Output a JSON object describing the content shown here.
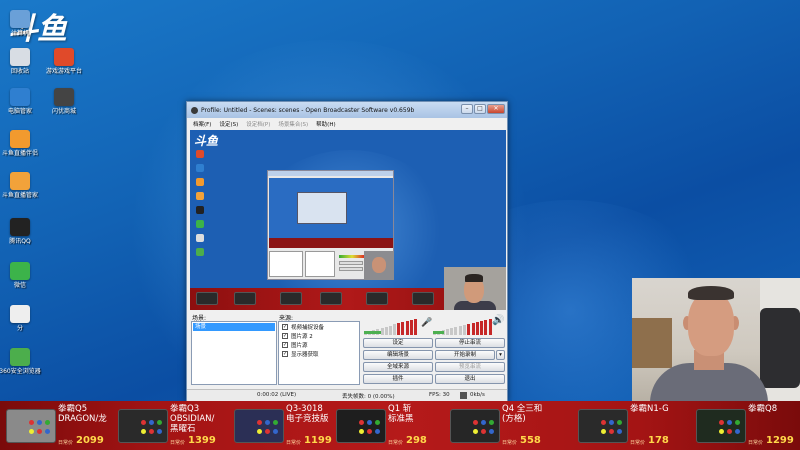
{
  "brand": {
    "logo_text": "斗鱼"
  },
  "desktop_icons": [
    {
      "label": "计算机",
      "color": "#6aa0d8"
    },
    {
      "label": "回收站",
      "color": "#d8dde4"
    },
    {
      "label": "游戏游戏平台",
      "color": "#e04a2a"
    },
    {
      "label": "电脑管家",
      "color": "#2f7fd0"
    },
    {
      "label": "闪优商城",
      "color": "#444444"
    },
    {
      "label": "斗鱼直播伴侣",
      "color": "#f29a2e"
    },
    {
      "label": "斗鱼直播管家",
      "color": "#f2a23a"
    },
    {
      "label": "腾讯QQ",
      "color": "#222222"
    },
    {
      "label": "微信",
      "color": "#3cb34a"
    },
    {
      "label": "分",
      "color": "#eeeeee"
    },
    {
      "label": "360安全浏览器",
      "color": "#4cae4c"
    }
  ],
  "obs": {
    "title": "Profile: Untitled - Scenes: scenes - Open Broadcaster Software v0.659b",
    "window_buttons": {
      "minimize": "–",
      "maximize": "□",
      "close": "✕"
    },
    "menu": [
      {
        "label": "档案(F)",
        "enabled": true
      },
      {
        "label": "设定(S)",
        "enabled": true
      },
      {
        "label": "设定档(P)",
        "enabled": false
      },
      {
        "label": "场景集合(S)",
        "enabled": false
      },
      {
        "label": "帮助(H)",
        "enabled": true
      }
    ],
    "scenes_label": "场景:",
    "scenes": [
      "场景"
    ],
    "sources_label": "来源:",
    "sources": [
      {
        "label": "视频捕捉设备",
        "checked": true
      },
      {
        "label": "图片源 2",
        "checked": true
      },
      {
        "label": "图片源",
        "checked": true
      },
      {
        "label": "显示器获取",
        "checked": true
      }
    ],
    "buttons": {
      "settings": "设定",
      "stop_stream": "停止串流",
      "edit_scene": "编辑场景",
      "start_recording": "开始录制",
      "global_sources": "全域来源",
      "preview_stream": "预览串流",
      "plugins": "插件",
      "exit": "退出"
    },
    "status": {
      "time": "0:00:02 (LIVE)",
      "dropped": "丢失帧数: 0 (0.00%)",
      "fps": "FPS: 30",
      "bitrate": "0kb/s"
    },
    "mic_level": 0.18,
    "desktop_level": 0.32
  },
  "products": [
    {
      "name": "拳霸Q5\nDRAGON/龙",
      "label": "日常价",
      "price": "2099",
      "color": "#8a8a8a"
    },
    {
      "name": "拳霸Q3\nOBSIDIAN/\n黑曜石",
      "label": "日常价",
      "price": "1399",
      "color": "#2a2a2a"
    },
    {
      "name": "Q3-3018\n电子竞技版",
      "label": "日常价",
      "price": "1199",
      "color": "#2b2f55"
    },
    {
      "name": "Q1 斩\n标准黑",
      "label": "日常价",
      "price": "298",
      "color": "#1e1e1e"
    },
    {
      "name": "Q4 全三和\n(方格)",
      "label": "日常价",
      "price": "558",
      "color": "#262626"
    },
    {
      "name": "拳霸N1-G",
      "label": "日常价",
      "price": "178",
      "color": "#2a2a2a"
    },
    {
      "name": "拳霸Q8",
      "label": "日常价",
      "price": "1299",
      "color": "#1f2b1f"
    }
  ]
}
